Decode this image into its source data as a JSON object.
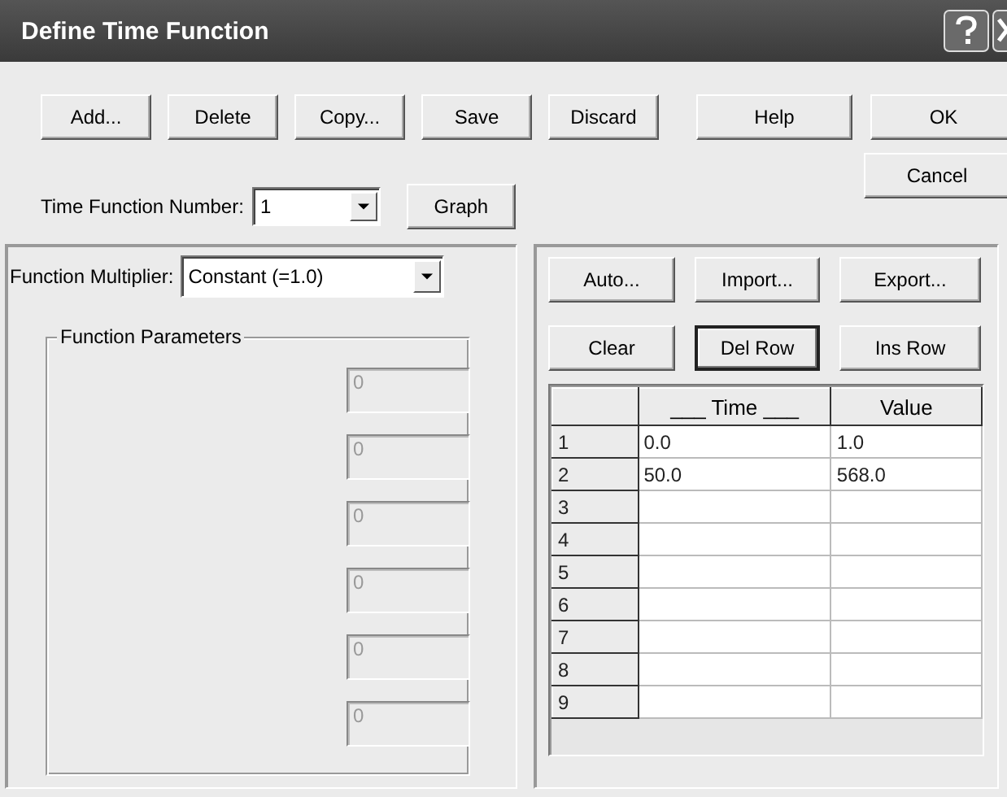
{
  "window": {
    "title": "Define Time Function"
  },
  "top_buttons": [
    {
      "label": "Add..."
    },
    {
      "label": "Delete"
    },
    {
      "label": "Copy..."
    },
    {
      "label": "Save"
    },
    {
      "label": "Discard"
    },
    {
      "label": "Help"
    },
    {
      "label": "OK"
    }
  ],
  "cancel_button": {
    "label": "Cancel"
  },
  "time_function_number": {
    "label": "Time Function Number:",
    "value": "1"
  },
  "graph_button": {
    "label": "Graph"
  },
  "function_multiplier": {
    "label": "Function Multiplier:",
    "value": "Constant (=1.0)"
  },
  "function_parameters": {
    "title": "Function Parameters",
    "fields": [
      {
        "value": "0",
        "disabled": true
      },
      {
        "value": "0",
        "disabled": true
      },
      {
        "value": "0",
        "disabled": true
      },
      {
        "value": "0",
        "disabled": true
      },
      {
        "value": "0",
        "disabled": true
      },
      {
        "value": "0",
        "disabled": true
      }
    ]
  },
  "table_buttons": [
    {
      "label": "Auto...",
      "default": false
    },
    {
      "label": "Import...",
      "default": false
    },
    {
      "label": "Export...",
      "default": false
    },
    {
      "label": "Clear",
      "default": false
    },
    {
      "label": "Del Row",
      "default": true
    },
    {
      "label": "Ins Row",
      "default": false
    }
  ],
  "table": {
    "columns": [
      "___ Time ___",
      "Value"
    ],
    "rows": [
      {
        "number": "1",
        "cells": [
          "0.0",
          "1.0"
        ]
      },
      {
        "number": "2",
        "cells": [
          "50.0",
          "568.0"
        ]
      },
      {
        "number": "3"
      },
      {
        "number": "4"
      },
      {
        "number": "5"
      },
      {
        "number": "6"
      },
      {
        "number": "7"
      },
      {
        "number": "8"
      },
      {
        "number": "9"
      }
    ]
  }
}
